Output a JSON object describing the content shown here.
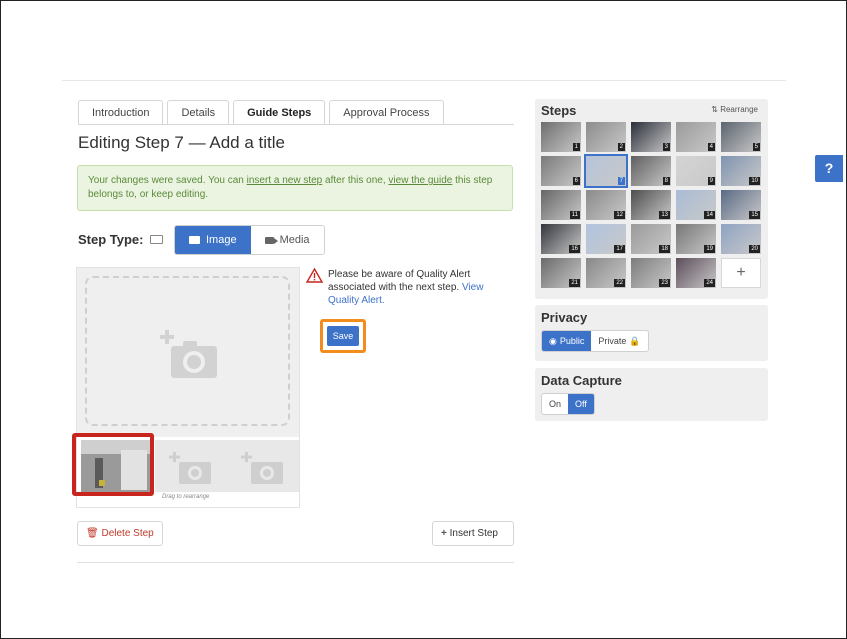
{
  "tabs": [
    {
      "label": "Introduction",
      "active": false
    },
    {
      "label": "Details",
      "active": false
    },
    {
      "label": "Guide Steps",
      "active": true
    },
    {
      "label": "Approval Process",
      "active": false
    }
  ],
  "page_title": "Editing Step 7 — Add a title",
  "success_alert": {
    "text_1": "Your changes were saved. You can ",
    "link_insert": "insert a new step",
    "text_2": " after this one, ",
    "link_view": "view the guide",
    "text_3": " this step belongs to, or keep editing."
  },
  "step_type": {
    "label": "Step Type:",
    "options": [
      "Image",
      "Media"
    ],
    "selected": "Image"
  },
  "media": {
    "drag_hint": "Drag to rearrange"
  },
  "quality_alert": {
    "text": "Please be aware of Quality Alert associated with the next step. ",
    "link": "View Quality Alert.",
    "save_label": "Save"
  },
  "actions": {
    "delete_label": "Delete Step",
    "insert_label": "Insert Step"
  },
  "sidebar": {
    "steps_title": "Steps",
    "rearrange_label": "Rearrange",
    "steps": [
      "1",
      "2",
      "3",
      "4",
      "5",
      "6",
      "7",
      "8",
      "9",
      "10",
      "11",
      "12",
      "13",
      "14",
      "15",
      "16",
      "17",
      "18",
      "19",
      "20",
      "21",
      "22",
      "23",
      "24"
    ],
    "add_label": "+",
    "privacy": {
      "title": "Privacy",
      "options": [
        "Public",
        "Private"
      ],
      "selected": "Public"
    },
    "data_capture": {
      "title": "Data Capture",
      "options": [
        "On",
        "Off"
      ],
      "selected": "Off"
    }
  },
  "help_label": "?",
  "colors": {
    "accent": "#3d72c9",
    "danger": "#c0392b",
    "highlight_red": "#c8251e",
    "highlight_orange": "#f28c1c",
    "success_bg": "#eaf4e1"
  }
}
